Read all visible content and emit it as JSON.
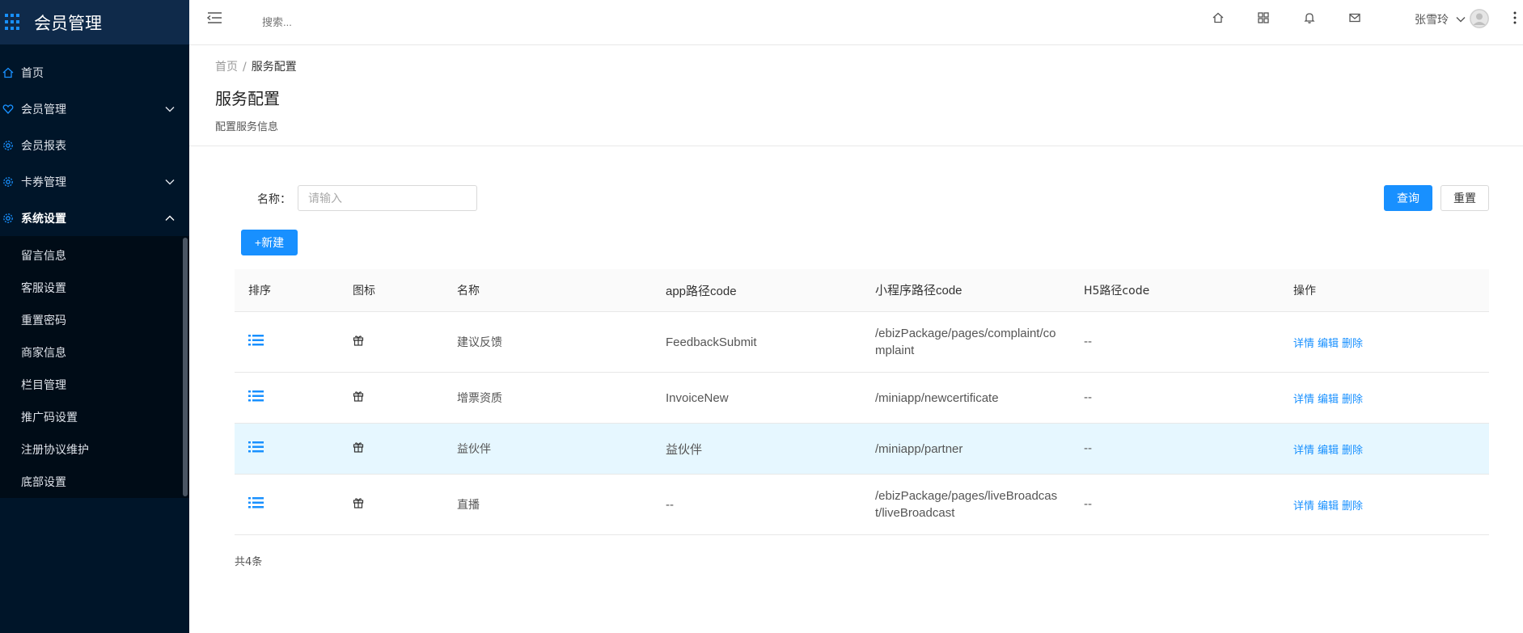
{
  "app": {
    "title": "会员管理"
  },
  "sidebar": {
    "items": [
      {
        "label": "首页",
        "icon": "home-icon"
      },
      {
        "label": "会员管理",
        "icon": "heart-icon"
      },
      {
        "label": "会员报表",
        "icon": "gear-icon"
      },
      {
        "label": "卡券管理",
        "icon": "gear-icon"
      },
      {
        "label": "系统设置",
        "icon": "gear-icon"
      }
    ],
    "submenu": [
      "留言信息",
      "客服设置",
      "重置密码",
      "商家信息",
      "栏目管理",
      "推广码设置",
      "注册协议维护",
      "底部设置"
    ]
  },
  "topbar": {
    "search_placeholder": "搜索...",
    "user_name": "张雪玲"
  },
  "page": {
    "breadcrumb": {
      "home": "首页",
      "sep": "/",
      "current": "服务配置"
    },
    "title": "服务配置",
    "description": "配置服务信息"
  },
  "filter": {
    "name_label": "名称：",
    "name_placeholder": "请输入",
    "query_label": "查询",
    "reset_label": "重置",
    "new_label": "+新建"
  },
  "table": {
    "headers": [
      "排序",
      "图标",
      "名称",
      "app路径code",
      "小程序路径code",
      "H5路径code",
      "操作"
    ],
    "rows": [
      {
        "name": "建议反馈",
        "app_code": "FeedbackSubmit",
        "mini_code": "/ebizPackage/pages/complaint/complaint",
        "h5_code": "--"
      },
      {
        "name": "增票资质",
        "app_code": "InvoiceNew",
        "mini_code": "/miniapp/newcertificate",
        "h5_code": "--"
      },
      {
        "name": "益伙伴",
        "app_code": "益伙伴",
        "mini_code": "/miniapp/partner",
        "h5_code": "--"
      },
      {
        "name": "直播",
        "app_code": "--",
        "mini_code": "/ebizPackage/pages/liveBroadcast/liveBroadcast",
        "h5_code": "--"
      }
    ],
    "actions": {
      "detail": "详情",
      "edit": "编辑",
      "delete": "删除"
    },
    "total": "共4条"
  },
  "colors": {
    "primary": "#1890ff",
    "sidebar_bg": "#001529",
    "row_highlight": "#e6f7ff"
  }
}
